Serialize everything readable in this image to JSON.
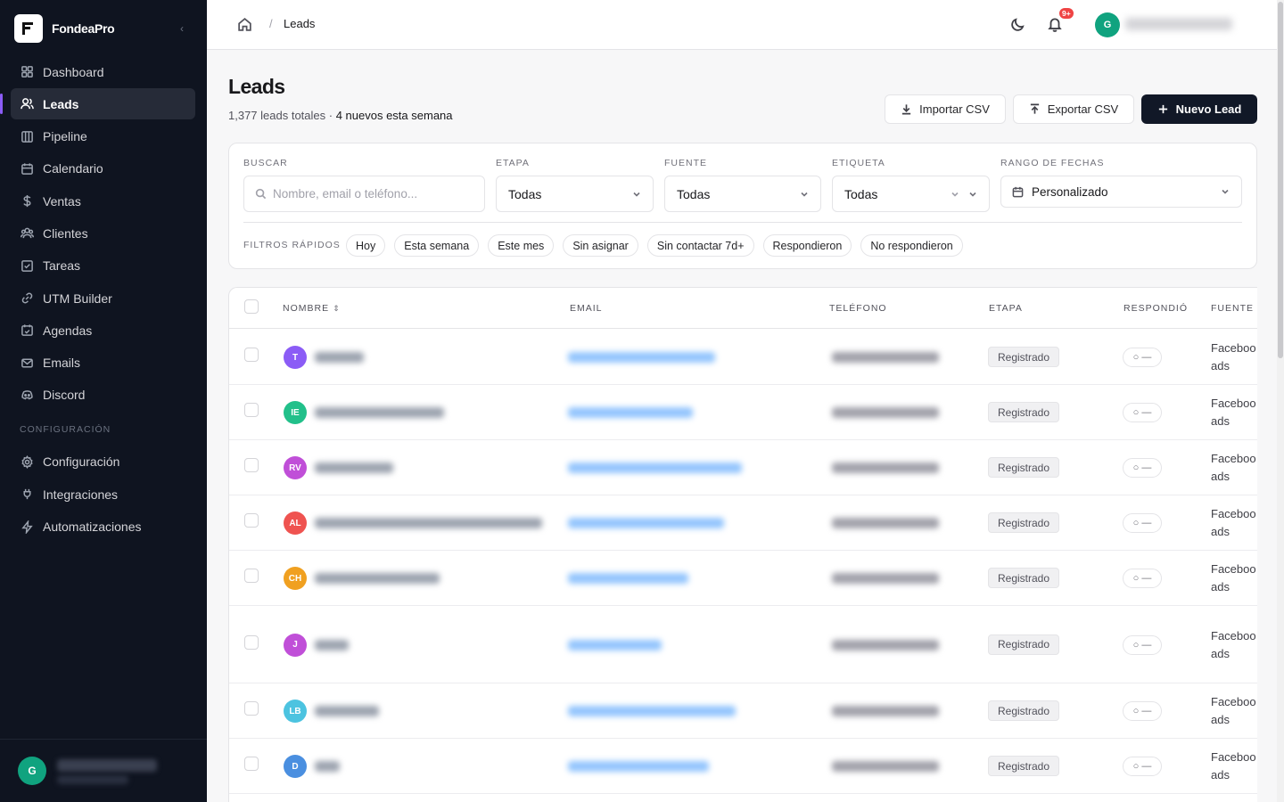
{
  "brand": {
    "name": "FondeaPro"
  },
  "sidebar": {
    "items": [
      {
        "label": "Dashboard",
        "icon": "grid-icon"
      },
      {
        "label": "Leads",
        "icon": "users-icon",
        "active": true
      },
      {
        "label": "Pipeline",
        "icon": "columns-icon"
      },
      {
        "label": "Calendario",
        "icon": "calendar-icon"
      },
      {
        "label": "Ventas",
        "icon": "dollar-icon"
      },
      {
        "label": "Clientes",
        "icon": "people-icon"
      },
      {
        "label": "Tareas",
        "icon": "checklist-icon"
      },
      {
        "label": "UTM Builder",
        "icon": "link-icon"
      },
      {
        "label": "Agendas",
        "icon": "calendar-check-icon"
      },
      {
        "label": "Emails",
        "icon": "mail-icon"
      },
      {
        "label": "Discord",
        "icon": "discord-icon"
      }
    ],
    "section_label": "CONFIGURACIÓN",
    "config_items": [
      {
        "label": "Configuración",
        "icon": "gear-icon"
      },
      {
        "label": "Integraciones",
        "icon": "plug-icon"
      },
      {
        "label": "Automatizaciones",
        "icon": "bolt-icon"
      }
    ],
    "user_initial": "G"
  },
  "topbar": {
    "breadcrumb_current": "Leads",
    "breadcrumb_sep": "/",
    "notification_count": "9+",
    "user_initial": "G"
  },
  "header": {
    "title": "Leads",
    "total": "1,377 leads totales",
    "dot": " · ",
    "new_week": "4 nuevos esta semana",
    "import_label": "Importar CSV",
    "export_label": "Exportar CSV",
    "new_label": "Nuevo Lead"
  },
  "filters": {
    "search_label": "BUSCAR",
    "search_placeholder": "Nombre, email o teléfono...",
    "etapa_label": "ETAPA",
    "etapa_value": "Todas",
    "fuente_label": "FUENTE",
    "fuente_value": "Todas",
    "etiqueta_label": "ETIQUETA",
    "etiqueta_value": "Todas",
    "fecha_label": "RANGO DE FECHAS",
    "fecha_value": "Personalizado",
    "quick_label": "FILTROS RÁPIDOS",
    "quick": [
      "Hoy",
      "Esta semana",
      "Este mes",
      "Sin asignar",
      "Sin contactar 7d+",
      "Respondieron",
      "No respondieron"
    ]
  },
  "table": {
    "columns": {
      "nombre": "NOMBRE",
      "email": "EMAIL",
      "telefono": "TELÉFONO",
      "etapa": "ETAPA",
      "respondio": "RESPONDIÓ",
      "fuente": "FUENTE"
    },
    "rows": [
      {
        "initials": "T",
        "color": "#8b5cf6",
        "stage": "Registrado",
        "responded": "○ —",
        "source_1": "Faceboo",
        "source_2": "ads"
      },
      {
        "initials": "IE",
        "color": "#22c08a",
        "stage": "Registrado",
        "responded": "○ —",
        "source_1": "Faceboo",
        "source_2": "ads"
      },
      {
        "initials": "RV",
        "color": "#c04fd8",
        "stage": "Registrado",
        "responded": "○ —",
        "source_1": "Faceboo",
        "source_2": "ads"
      },
      {
        "initials": "AL",
        "color": "#ef5350",
        "stage": "Registrado",
        "responded": "○ —",
        "source_1": "Faceboo",
        "source_2": "ads"
      },
      {
        "initials": "CH",
        "color": "#f0a020",
        "stage": "Registrado",
        "responded": "○ —",
        "source_1": "Faceboo",
        "source_2": "ads"
      },
      {
        "initials": "J",
        "color": "#c04fd8",
        "stage": "Registrado",
        "responded": "○ —",
        "source_1": "Faceboo",
        "source_2": "ads"
      },
      {
        "initials": "LB",
        "color": "#4cc3e0",
        "stage": "Registrado",
        "responded": "○ —",
        "source_1": "Faceboo",
        "source_2": "ads"
      },
      {
        "initials": "D",
        "color": "#4a8fe0",
        "stage": "Registrado",
        "responded": "○ —",
        "source_1": "Faceboo",
        "source_2": "ads"
      }
    ]
  }
}
